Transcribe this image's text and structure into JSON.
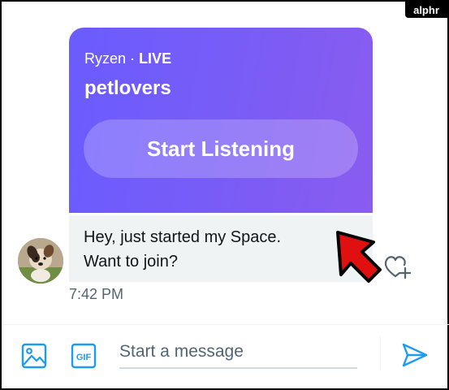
{
  "brand": {
    "logo_text": "alphr"
  },
  "space_card": {
    "host": "Ryzen",
    "separator": "·",
    "status": "LIVE",
    "title": "petlovers",
    "listen_label": "Start Listening"
  },
  "message": {
    "line1": "Hey, just started my Space.",
    "line2": "Want to join?",
    "time": "7:42 PM"
  },
  "composer": {
    "placeholder": "Start a message",
    "value": "",
    "gif_label": "GIF"
  },
  "colors": {
    "card_gradient_start": "#6a5cff",
    "card_gradient_end": "#8a5cf0",
    "accent_blue": "#1d9bf0",
    "annotation_arrow": "#e01010"
  },
  "icons": {
    "image": "image-icon",
    "gif": "gif-icon",
    "send": "send-icon",
    "react": "heart-plus-icon",
    "annotation": "red-arrow-icon"
  }
}
